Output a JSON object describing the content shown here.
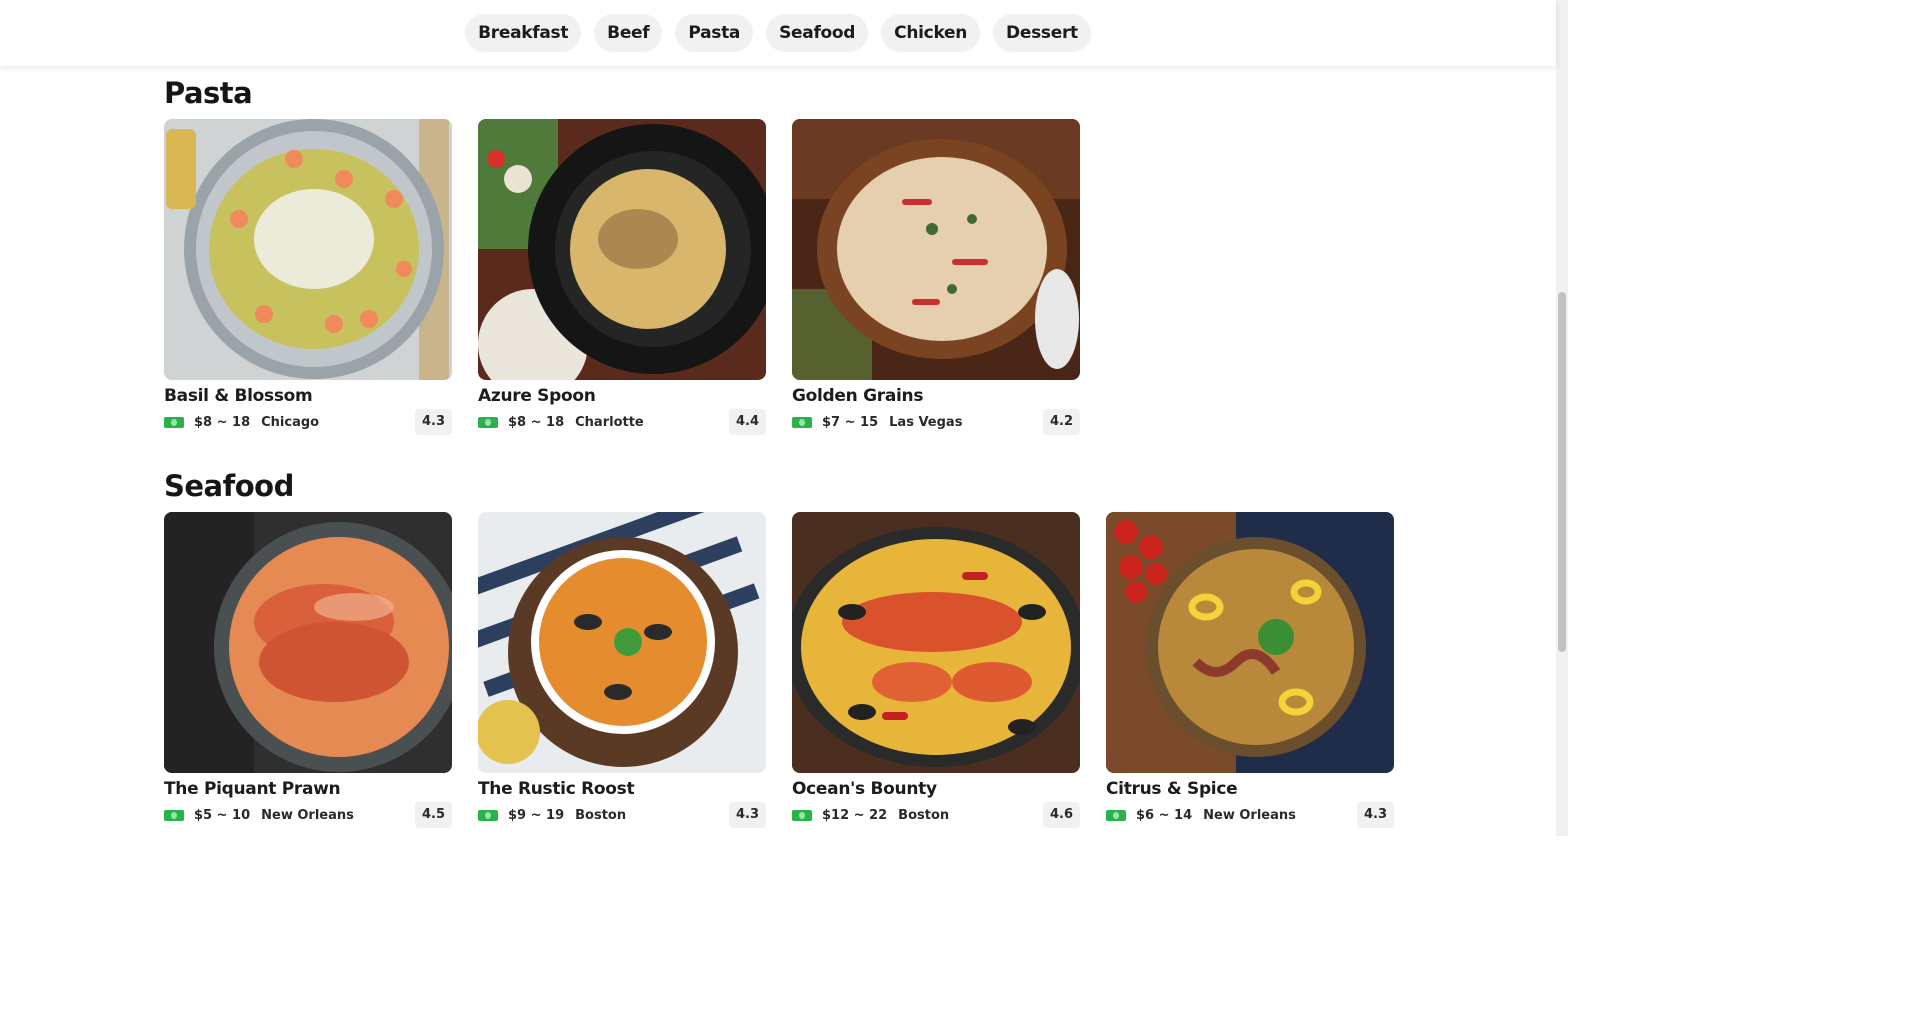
{
  "nav": {
    "categories": [
      "Breakfast",
      "Beef",
      "Pasta",
      "Seafood",
      "Chicken",
      "Dessert"
    ]
  },
  "sections": [
    {
      "title": "Pasta",
      "cards": [
        {
          "name": "Basil & Blossom",
          "price": "$8 ~ 18",
          "city": "Chicago",
          "rating": "4.3"
        },
        {
          "name": "Azure Spoon",
          "price": "$8 ~ 18",
          "city": "Charlotte",
          "rating": "4.4"
        },
        {
          "name": "Golden Grains",
          "price": "$7 ~ 15",
          "city": "Las Vegas",
          "rating": "4.2"
        }
      ]
    },
    {
      "title": "Seafood",
      "cards": [
        {
          "name": "The Piquant Prawn",
          "price": "$5 ~ 10",
          "city": "New Orleans",
          "rating": "4.5"
        },
        {
          "name": "The Rustic Roost",
          "price": "$9 ~ 19",
          "city": "Boston",
          "rating": "4.3"
        },
        {
          "name": "Ocean's Bounty",
          "price": "$12 ~ 22",
          "city": "Boston",
          "rating": "4.6"
        },
        {
          "name": "Citrus & Spice",
          "price": "$6 ~ 14",
          "city": "New Orleans",
          "rating": "4.3"
        }
      ]
    }
  ],
  "icons": {
    "price": "money-icon"
  },
  "colors": {
    "money_icon": "#27b34a",
    "chip_bg": "#f1f1f1",
    "rating_bg": "#f1f1f1"
  }
}
